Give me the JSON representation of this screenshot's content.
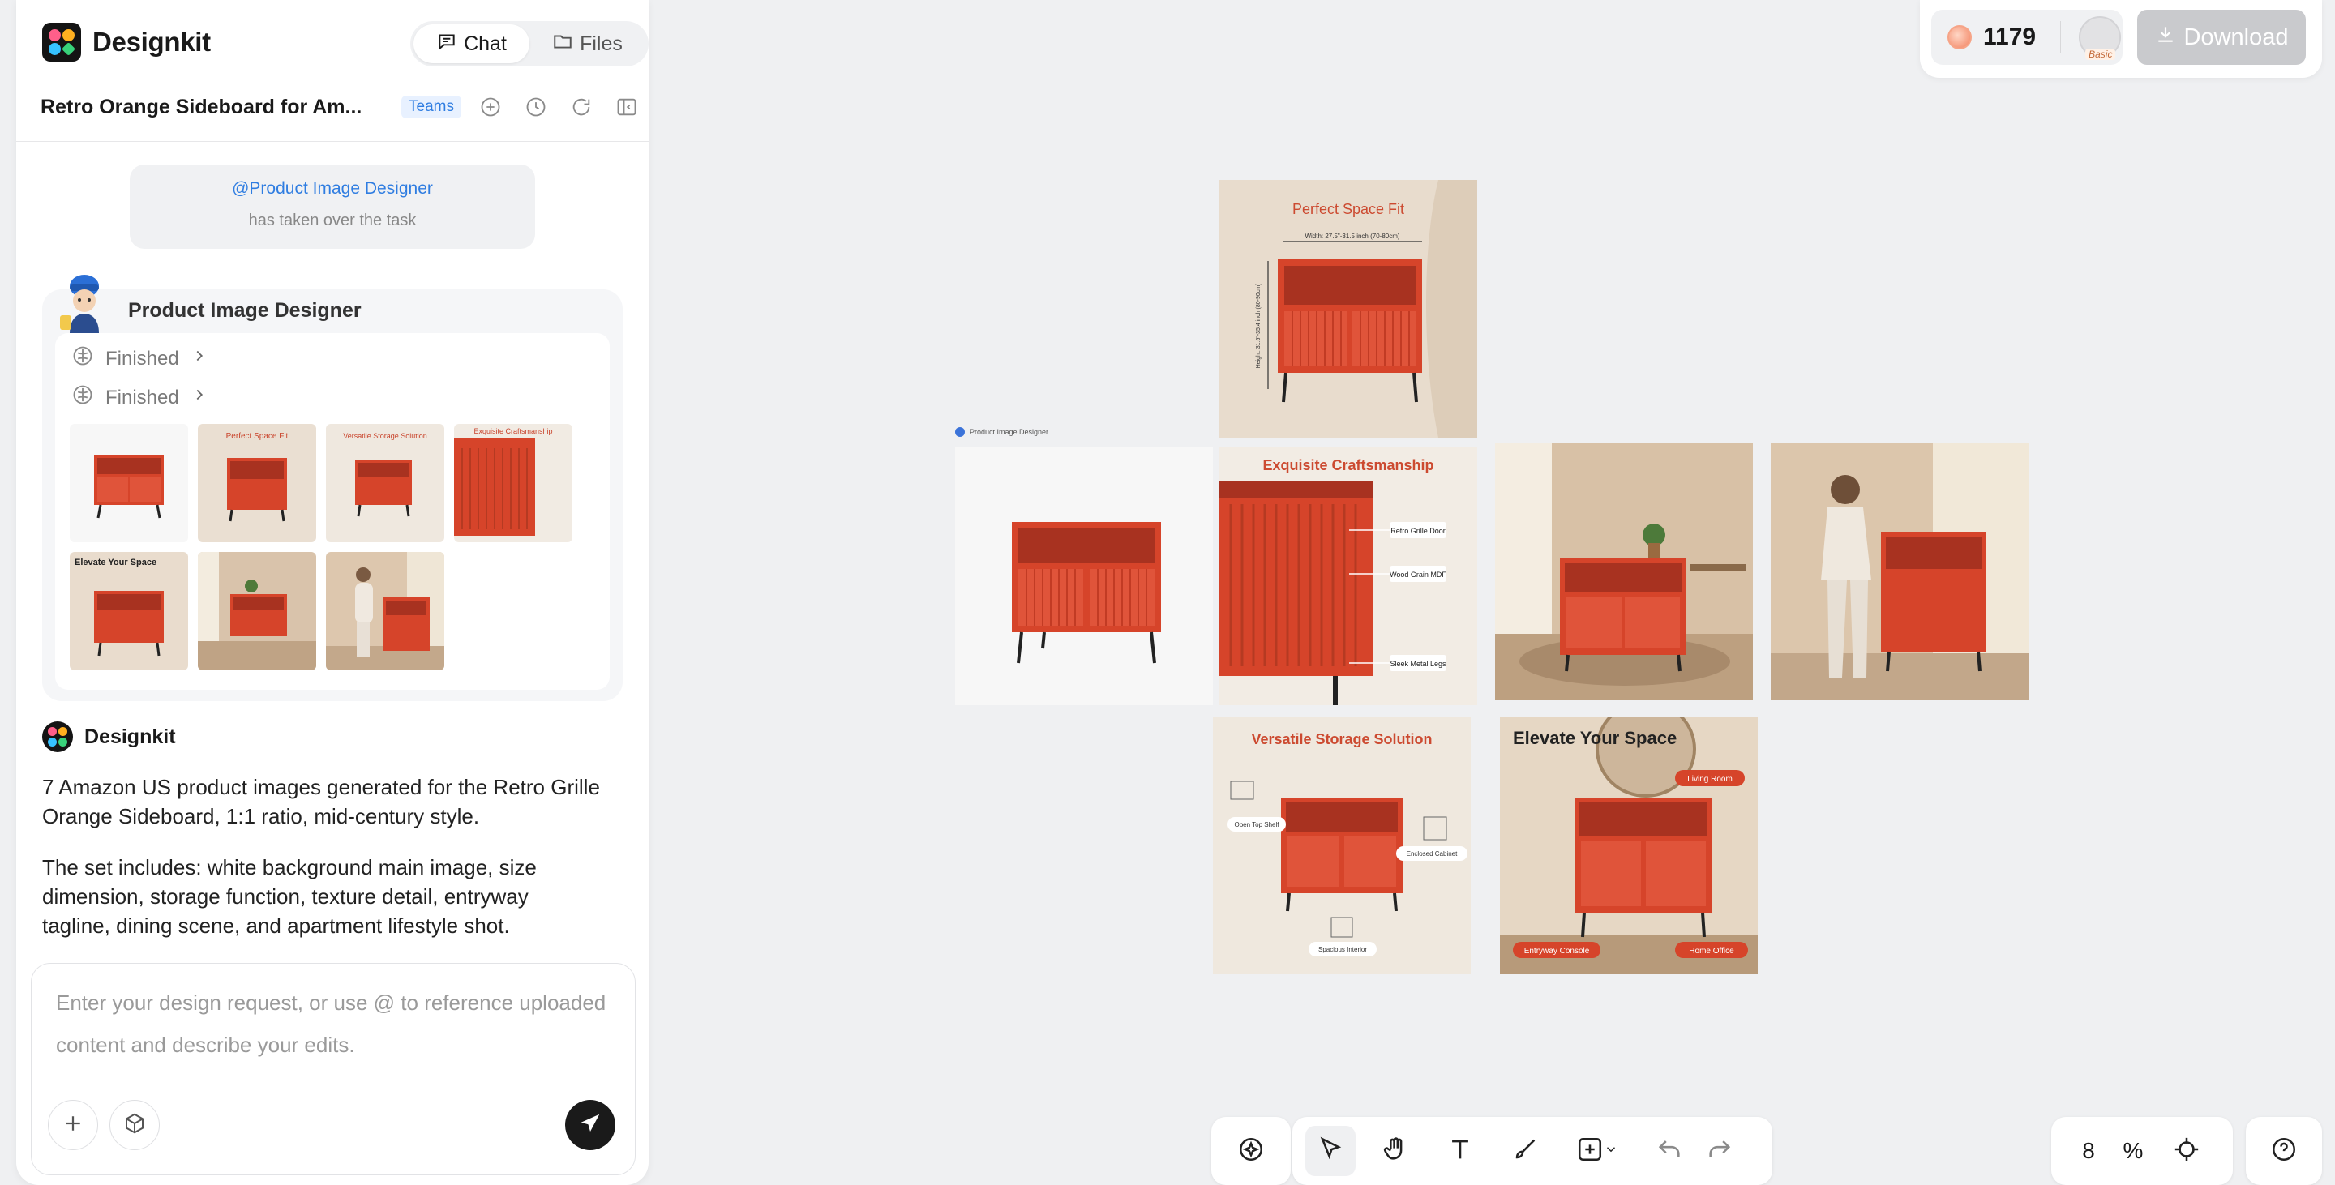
{
  "app": {
    "name": "Designkit"
  },
  "tabs": [
    {
      "label": "Chat",
      "active": true
    },
    {
      "label": "Files",
      "active": false
    }
  ],
  "task": {
    "title": "Retro Orange Sideboard for Am...",
    "tag": "Teams"
  },
  "takeover": {
    "agent": "@Product Image Designer",
    "text": "has taken over the task"
  },
  "agent": {
    "name": "Product Image Designer",
    "steps": [
      {
        "label": "Finished"
      },
      {
        "label": "Finished"
      }
    ],
    "thumbnails": [
      {
        "kind": "white-bg",
        "caption": ""
      },
      {
        "kind": "size",
        "caption": "Perfect Space Fit"
      },
      {
        "kind": "storage",
        "caption": "Versatile Storage Solution"
      },
      {
        "kind": "craft",
        "caption": "Exquisite Craftsmanship"
      },
      {
        "kind": "elevate",
        "caption": "Elevate Your Space"
      },
      {
        "kind": "room",
        "caption": ""
      },
      {
        "kind": "woman",
        "caption": ""
      }
    ]
  },
  "assistant": {
    "name": "Designkit",
    "messages": [
      "7 Amazon US product images generated for the Retro Grille Orange Sideboard, 1:1 ratio, mid-century style.",
      "The set includes: white background main image, size dimension, storage function, texture detail, entryway tagline, dining scene, and apartment lifestyle shot."
    ]
  },
  "composer": {
    "placeholder": "Enter your design request, or use @ to reference uploaded content and describe your edits."
  },
  "account": {
    "credits": "1179",
    "plan": "Basic",
    "download_label": "Download"
  },
  "canvas": {
    "group_label": "Product Image Designer",
    "images": {
      "size": {
        "title": "Perfect Space Fit",
        "width_note": "Width: 27.5\"-31.5 inch (70-80cm)",
        "height_note": "Height: 31.5\"-35.4 inch (80-90cm)"
      },
      "craft": {
        "title": "Exquisite Craftsmanship",
        "callouts": [
          "Retro Grille Door",
          "Wood Grain MDF",
          "Sleek Metal Legs"
        ]
      },
      "storage": {
        "title": "Versatile Storage Solution",
        "callouts": [
          "Open Top Shelf",
          "Enclosed Cabinet",
          "Spacious Interior"
        ]
      },
      "elevate": {
        "title": "Elevate Your Space",
        "callouts": [
          "Living Room",
          "Entryway Console",
          "Home Office"
        ]
      }
    }
  },
  "zoom": {
    "value": "8",
    "unit": "%"
  },
  "colors": {
    "accent": "#2f7de1",
    "product": "#d9452a",
    "canvas": "#eff0f2"
  }
}
